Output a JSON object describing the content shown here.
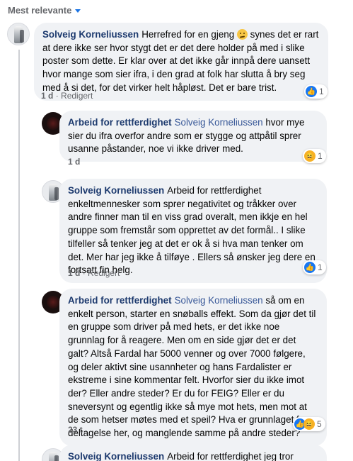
{
  "sort": {
    "label": "Mest relevante"
  },
  "comments": [
    {
      "author": "Solveig Korneliussen",
      "text_before_emoji": "Herrefred for en gjeng ",
      "text_after_emoji": " synes det er rart at dere ikke ser hvor stygt det er det dere holder på med i slike poster som dette. Er klar over at det ikke går innpå dere uansett hvor mange som sier ifra, i den grad at folk har slutta å bry seg med å si det, for det virker helt håpløst. Det er bare trist.",
      "emoji": "confused-face",
      "time": "1 d",
      "edited": "Redigert",
      "reaction_count": "1",
      "reactions": [
        "like-icon"
      ]
    },
    {
      "author": "Arbeid for rettferdighet",
      "tag": "Solveig Korneliussen",
      "text": "hvor mye sier du ifra overfor andre som er stygge og attpåtil sprer usanne påstander, noe vi ikke driver med.",
      "time": "1 d",
      "reaction_count": "1",
      "reactions": [
        "haha-icon"
      ]
    },
    {
      "author": "Solveig Korneliussen",
      "text": "Arbeid for rettferdighet enkeltmennesker som sprer negativitet og tråkker over andre finner man til en viss grad overalt, men ikkje en hel gruppe som fremstår som opprettet av det formål.. I slike tilfeller så tenker jeg at det er ok å si hva man tenker om det. Mer har jeg ikke å tilføye . Ellers så ønsker jeg dere en fortsatt fin helg.",
      "time": "1 d",
      "edited": "Redigert",
      "reaction_count": "1",
      "reactions": [
        "like-icon"
      ]
    },
    {
      "author": "Arbeid for rettferdighet",
      "tag": "Solveig Korneliussen",
      "text": "så om en enkelt person, starter en snøballs effekt. Som da gjør det til en gruppe som driver på med hets, er det ikke noe grunnlag for å reagere. Men om en side gjør det er det galt? Altså Fardal har 5000 venner og over 7000 følgere, og deler aktivt sine usannheter og hans Fardalister er ekstreme i sine kommentar felt. Hvorfor sier du ikke imot der? Eller andre steder? Er du for FEIG? Eller er du sneversynt og egentlig ikke så mye mot hets, men mot at de som hetser møtes med et speil? Hva er grunnlaget for deltagelse her, og manglende samme på andre steder?",
      "time": "23 t",
      "reaction_count": "5",
      "reactions": [
        "like-icon",
        "haha-icon"
      ]
    },
    {
      "author": "Solveig Korneliussen",
      "text": "Arbeid for rettferdighet jeg tror"
    }
  ]
}
